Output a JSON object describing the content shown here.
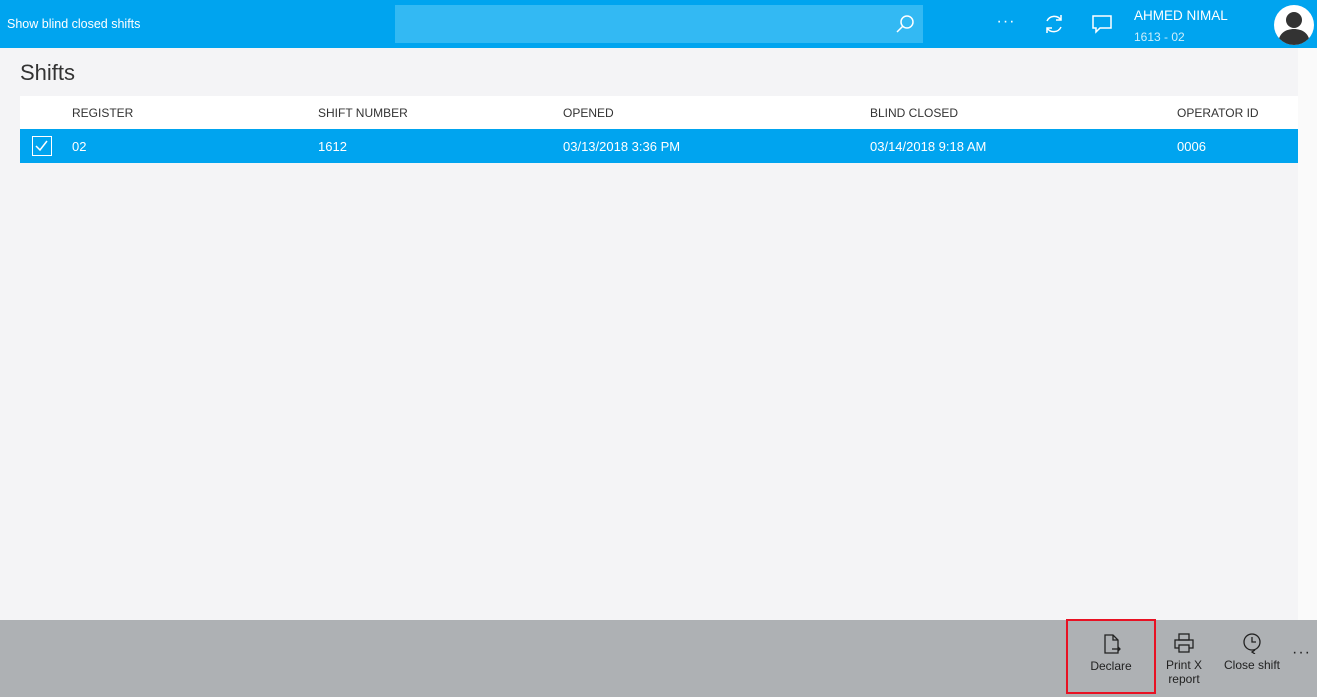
{
  "topbar": {
    "page_tag": "Show blind closed shifts",
    "search_placeholder": "",
    "more_label": "···",
    "user_name": "AHMED NIMAL",
    "user_sub": "1613 - 02"
  },
  "page": {
    "title": "Shifts"
  },
  "table": {
    "columns": [
      "REGISTER",
      "SHIFT NUMBER",
      "OPENED",
      "BLIND CLOSED",
      "OPERATOR ID"
    ],
    "rows": [
      {
        "register": "02",
        "shift_number": "1612",
        "opened": "03/13/2018 3:36 PM",
        "blind_closed": "03/14/2018 9:18 AM",
        "operator_id": "0006",
        "selected": true
      }
    ]
  },
  "appbar": {
    "declare": "Declare",
    "print_line1": "Print X",
    "print_line2": "report",
    "close_shift": "Close shift",
    "more_label": "···"
  },
  "colors": {
    "accent": "#00a4ef",
    "appbar": "#aeb1b4",
    "highlight": "#e81123"
  }
}
